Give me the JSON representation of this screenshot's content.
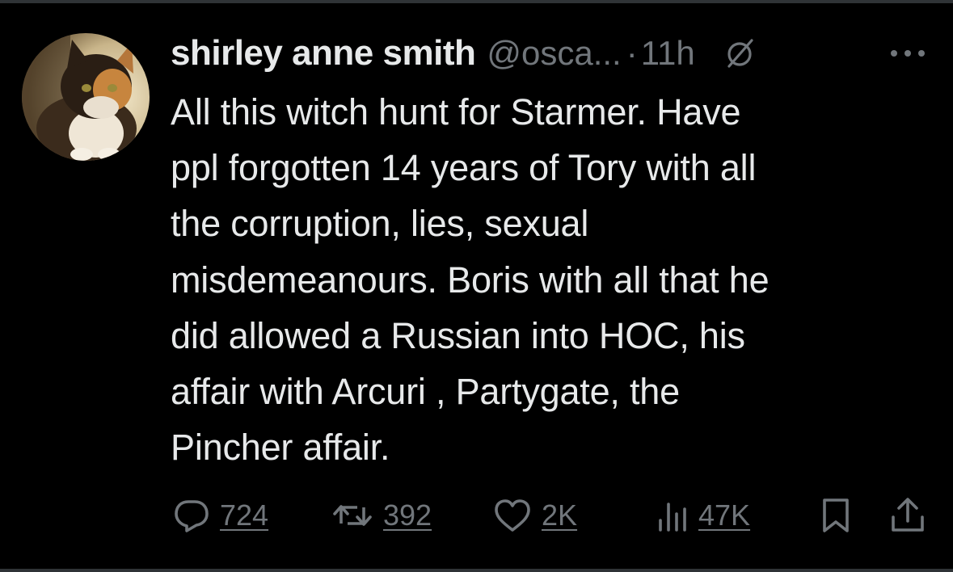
{
  "tweet": {
    "display_name": "shirley anne smith",
    "handle": "@osca...",
    "separator": "·",
    "time": "11h",
    "text": "All this witch hunt for Starmer.  Have\nppl forgotten 14 years of Tory with all\nthe corruption, lies, sexual\nmisdemeanours.  Boris with all that he\ndid allowed a Russian into HOC, his\naffair with Arcuri , Partygate, the\nPincher affair."
  },
  "icons": {
    "avatar": "cat-avatar",
    "grok": "grok-icon",
    "more": "more-icon",
    "reply": "reply-icon",
    "repost": "repost-icon",
    "like": "heart-icon",
    "views": "views-icon",
    "bookmark": "bookmark-icon",
    "share": "share-icon"
  },
  "actions": {
    "replies": "724",
    "reposts": "392",
    "likes": "2K",
    "views": "47K"
  },
  "colors": {
    "background": "#000000",
    "text_primary": "#e7e9ea",
    "text_secondary": "#71767b",
    "divider": "#2f3336"
  }
}
